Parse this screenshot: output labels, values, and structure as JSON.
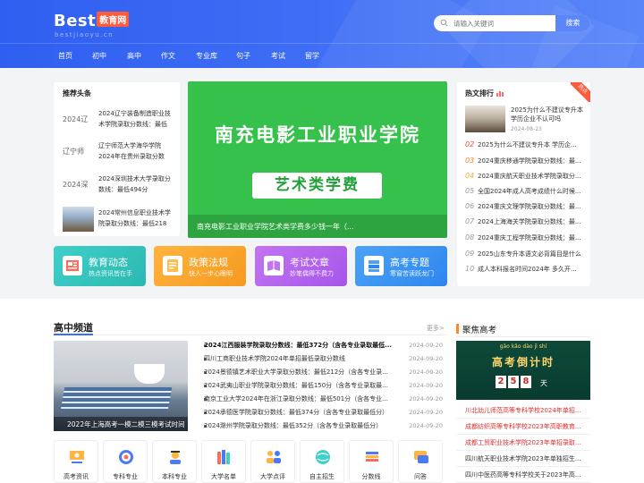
{
  "header": {
    "logo_main": "Best",
    "logo_badge": "教育网",
    "logo_sub": "bestjiaoyu.cn",
    "search_placeholder": "请输入关键词",
    "search_button": "搜索",
    "nav": [
      "首页",
      "初中",
      "高中",
      "作文",
      "专业库",
      "句子",
      "考试",
      "留学"
    ]
  },
  "recommend": {
    "title": "推荐头条",
    "items": [
      {
        "thumb": "2024辽",
        "text": "2024辽宁装备制造职业技术学院录取分数线：最低"
      },
      {
        "thumb": "辽宁师",
        "text": "辽宁师范大学海华学院2024年在贵州录取分数线："
      },
      {
        "thumb": "2024深",
        "text": "2024深圳技术大学录取分数线：最低494分"
      },
      {
        "thumb": "",
        "text": "2024常州信息职业技术学院录取分数线：最低218"
      }
    ]
  },
  "banner": {
    "title": "南充电影工业职业学院",
    "subtitle": "艺术类学费",
    "caption": "南充电影工业职业学院艺术类学费多少钱一年（..."
  },
  "hot": {
    "title": "热文排行",
    "ribbon": "热点",
    "top": {
      "text": "2025为什么不建议专升本学历企业不认可吗",
      "date": "2024-08-23"
    },
    "items": [
      {
        "rank": "02",
        "text": "2025为什么不建议专升本 学历企..."
      },
      {
        "rank": "03",
        "text": "2024重庆移通学院录取分数线：最..."
      },
      {
        "rank": "04",
        "text": "2024重庆航天职业技术学院录取分..."
      },
      {
        "rank": "05",
        "text": "全国2024年成人高考成绩什么时候..."
      },
      {
        "rank": "06",
        "text": "2024重庆文理学院录取分数线：最..."
      },
      {
        "rank": "07",
        "text": "2024上海海关学院录取分数线：最..."
      },
      {
        "rank": "08",
        "text": "2024重庆工程学院录取分数线：最..."
      },
      {
        "rank": "09",
        "text": "2025山东专升本语文必背篇目是什么"
      },
      {
        "rank": "10",
        "text": "成人本科报名时间2024年 多久开..."
      }
    ]
  },
  "quick": [
    {
      "title": "教育动态",
      "sub": "热点资讯皆在手",
      "c1": "#3fd0c9",
      "c2": "#2bb8b0"
    },
    {
      "title": "政策法规",
      "sub": "快人一步心眼明",
      "c1": "#ffb340",
      "c2": "#f59a1f"
    },
    {
      "title": "考试文章",
      "sub": "妙笔偶得不费力",
      "c1": "#c274f2",
      "c2": "#a656e8"
    },
    {
      "title": "高考专题",
      "sub": "寒窗苦读跃龙门",
      "c1": "#4aa3f7",
      "c2": "#2f86ee"
    }
  ],
  "channel": {
    "title": "高中频道",
    "more": "更多>",
    "image_caption": "2022年上海高考一模二模三模考试时间",
    "news": [
      {
        "text": "2024江西服装学院录取分数线：最低372分（含各专业录取最低...",
        "date": "2024-09-20",
        "bold": true
      },
      {
        "text": "四川工商职业技术学院2024年单招最低录取分数线",
        "date": "2024-09-20",
        "bold": false
      },
      {
        "text": "2024景德镇艺术职业大学录取分数线：最低212分（含各专业录...",
        "date": "2024-09-20",
        "bold": false
      },
      {
        "text": "2024武夷山职业学院录取分数线：最低150分（含各专业录取最...",
        "date": "2024-09-20",
        "bold": false
      },
      {
        "text": "南京工业大学2024年在浙江录取分数线：最低501分（含各专业...",
        "date": "2024-09-20",
        "bold": false
      },
      {
        "text": "2024承德医学院录取分数线：最低374分（含各专业录取最低分）",
        "date": "2024-09-20",
        "bold": false
      },
      {
        "text": "2024滁州学院录取分数线：最低352分（含各专业录取最低分）",
        "date": "2024-09-20",
        "bold": false
      }
    ],
    "icons": [
      "高考资讯",
      "专科专业",
      "本科专业",
      "大学名单",
      "大学点评",
      "自主招生",
      "分数线",
      "问答"
    ]
  },
  "focus": {
    "title": "聚焦高考",
    "pinyin": "gāo  kǎo  dào  jì  shí",
    "banner_text": "高考倒计时",
    "digits": [
      "2",
      "5",
      "8"
    ],
    "unit": "天",
    "items": [
      {
        "text": "川北幼儿师范高等专科学校2024年单招...",
        "red": true
      },
      {
        "text": "成都纺织高等专科学校2023年高职教育...",
        "red": true
      },
      {
        "text": "成都工贸职业技术学院2023年单招录取...",
        "red": true
      },
      {
        "text": "四川航天职业技术学院2023年单独招生...",
        "red": false
      },
      {
        "text": "四川中医药高等专科学校关于2023年高...",
        "red": false
      }
    ]
  }
}
